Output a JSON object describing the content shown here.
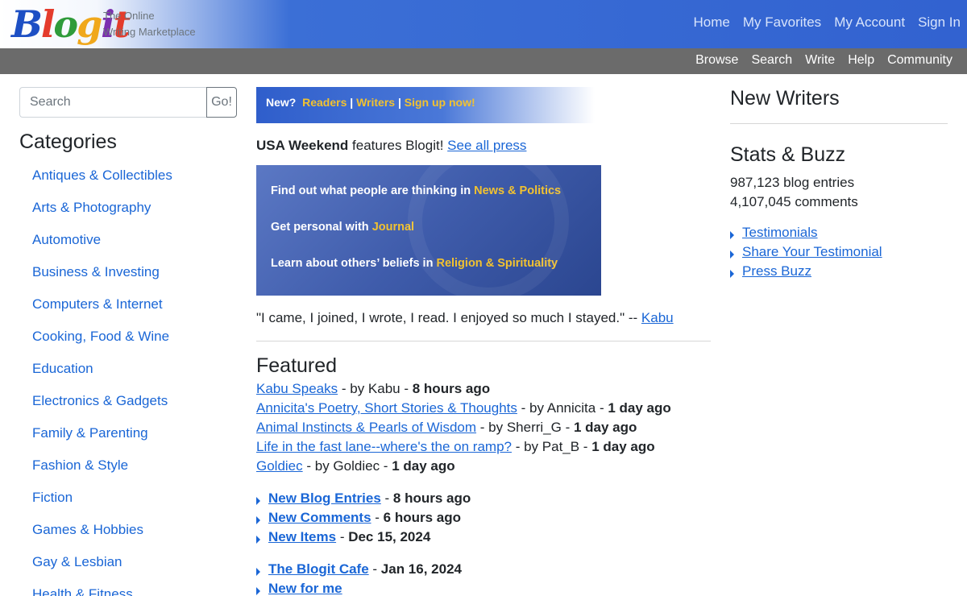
{
  "header": {
    "logo_letters": [
      "B",
      "l",
      "o",
      "g",
      "i",
      "t"
    ],
    "logo_colors": [
      "#1d4fc4",
      "#e43b2c",
      "#2f9b3a",
      "#f0a81c",
      "#7b2fb0",
      "#e43b2c"
    ],
    "tagline_line1": "The Online",
    "tagline_line2": "Writing Marketplace",
    "nav": [
      "Home",
      "My Favorites",
      "My Account",
      "Sign In"
    ]
  },
  "subnav": [
    "Browse",
    "Search",
    "Write",
    "Help",
    "Community"
  ],
  "search": {
    "placeholder": "Search",
    "button": "Go!"
  },
  "categories": {
    "heading": "Categories",
    "items": [
      "Antiques & Collectibles",
      "Arts & Photography",
      "Automotive",
      "Business & Investing",
      "Computers & Internet",
      "Cooking, Food & Wine",
      "Education",
      "Electronics & Gadgets",
      "Family & Parenting",
      "Fashion & Style",
      "Fiction",
      "Games & Hobbies",
      "Gay & Lesbian",
      "Health & Fitness"
    ]
  },
  "banner": {
    "new": "New?",
    "readers": "Readers",
    "writers": "Writers",
    "signup": "Sign up now!",
    "sep": "|"
  },
  "press": {
    "source": "USA Weekend",
    "text": " features Blogit! ",
    "link": "See all press"
  },
  "promo": {
    "line1_text": "Find out what people are thinking in ",
    "line1_hl": "News & Politics",
    "line2_text": "Get personal with ",
    "line2_hl": "Journal",
    "line3_text": "Learn about others’ beliefs in ",
    "line3_hl": "Religion & Spirituality"
  },
  "quote": {
    "text": "\"I came, I joined, I wrote, I read. I enjoyed so much I stayed.\" -- ",
    "author": "Kabu"
  },
  "featured": {
    "heading": "Featured",
    "items": [
      {
        "title": "Kabu Speaks",
        "by": " - by Kabu - ",
        "time": "8 hours ago"
      },
      {
        "title": "Annicita's Poetry, Short Stories & Thoughts",
        "by": " - by Annicita - ",
        "time": "1 day ago"
      },
      {
        "title": "Animal Instincts & Pearls of Wisdom",
        "by": " - by Sherri_G - ",
        "time": "1 day ago"
      },
      {
        "title": "Life in the fast lane--where's the on ramp?",
        "by": " - by Pat_B - ",
        "time": "1 day ago"
      },
      {
        "title": "Goldiec",
        "by": " - by Goldiec - ",
        "time": "1 day ago"
      }
    ]
  },
  "updates": [
    {
      "label": "New Blog Entries",
      "sep": " - ",
      "time": "8 hours ago"
    },
    {
      "label": "New Comments",
      "sep": " - ",
      "time": "6 hours ago"
    },
    {
      "label": "New Items",
      "sep": " - ",
      "time": "Dec 15, 2024"
    }
  ],
  "cafe": [
    {
      "label": "The Blogit Cafe",
      "sep": " - ",
      "time": "Jan 16, 2024"
    },
    {
      "label": "New for me",
      "sep": "",
      "time": ""
    }
  ],
  "right": {
    "new_writers": "New Writers",
    "stats_heading": "Stats & Buzz",
    "entries": "987,123 blog entries",
    "comments": "4,107,045 comments",
    "links": [
      "Testimonials",
      "Share Your Testimonial",
      "Press Buzz"
    ]
  }
}
